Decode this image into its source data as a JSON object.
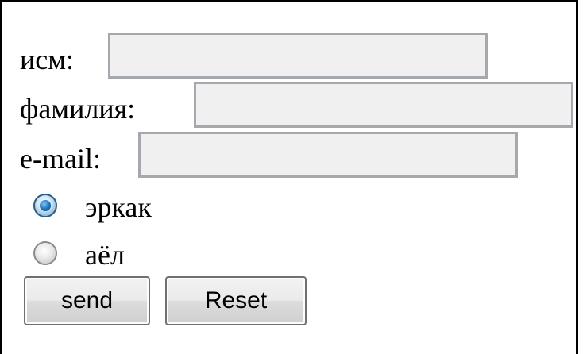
{
  "form": {
    "first_name": {
      "label": "исм:",
      "value": ""
    },
    "last_name": {
      "label": "фамилия:",
      "value": ""
    },
    "email": {
      "label": "e-mail:",
      "value": ""
    },
    "gender": {
      "options": [
        {
          "label": "эркак",
          "checked": true
        },
        {
          "label": "аёл",
          "checked": false
        }
      ]
    },
    "buttons": {
      "send_label": "send",
      "reset_label": "Reset"
    }
  }
}
